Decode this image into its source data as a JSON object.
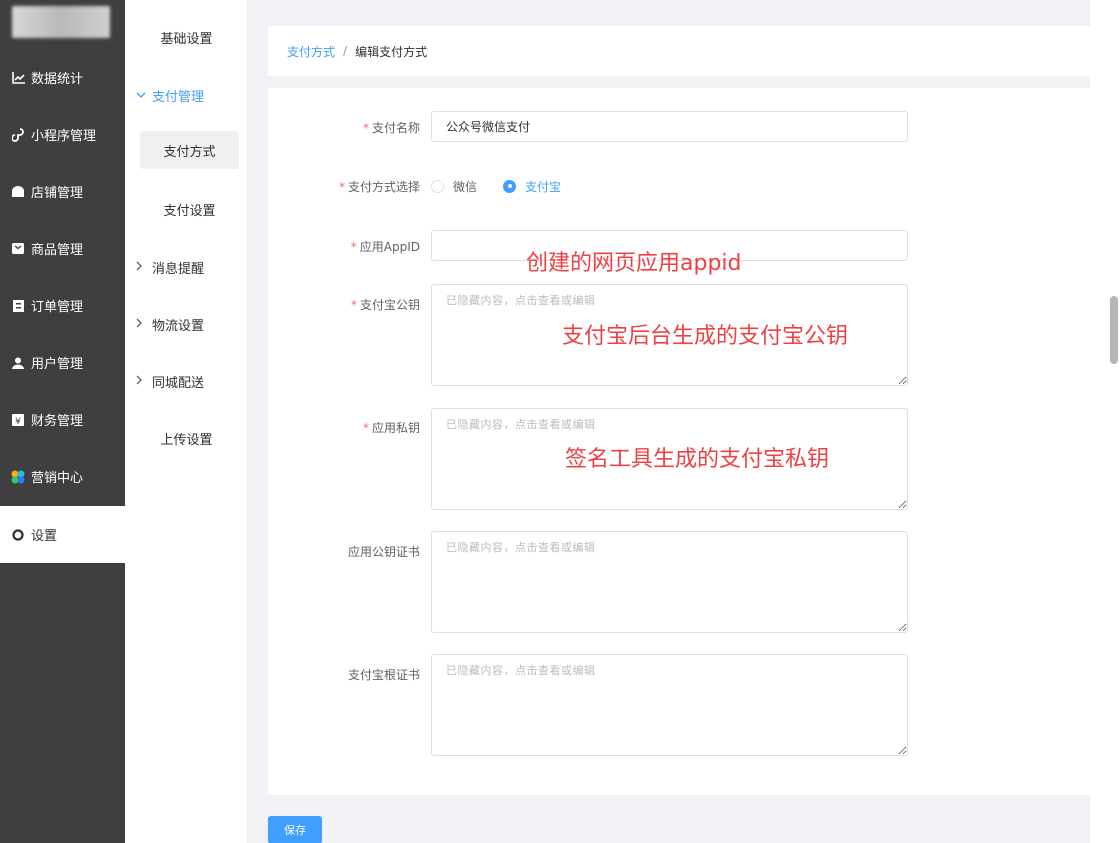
{
  "sidebar": {
    "items": [
      {
        "label": "数据统计",
        "icon": "chart-line-icon"
      },
      {
        "label": "小程序管理",
        "icon": "mini-program-icon"
      },
      {
        "label": "店铺管理",
        "icon": "store-icon"
      },
      {
        "label": "商品管理",
        "icon": "goods-icon"
      },
      {
        "label": "订单管理",
        "icon": "order-icon"
      },
      {
        "label": "用户管理",
        "icon": "user-icon"
      },
      {
        "label": "财务管理",
        "icon": "finance-icon"
      },
      {
        "label": "营销中心",
        "icon": "marketing-icon"
      },
      {
        "label": "设置",
        "icon": "settings-icon"
      }
    ]
  },
  "submenu": {
    "basic": "基础设置",
    "payment_group": "支付管理",
    "payment_methods": "支付方式",
    "payment_settings": "支付设置",
    "message": "消息提醒",
    "logistics": "物流设置",
    "local_delivery": "同城配送",
    "upload": "上传设置"
  },
  "breadcrumb": {
    "parent": "支付方式",
    "separator": "/",
    "current": "编辑支付方式"
  },
  "form": {
    "name_label": "支付名称",
    "name_value": "公众号微信支付",
    "method_label": "支付方式选择",
    "method_options": [
      "微信",
      "支付宝"
    ],
    "method_selected": "支付宝",
    "appid_label": "应用AppID",
    "appid_value": "",
    "alipay_pubkey_label": "支付宝公钥",
    "app_privkey_label": "应用私钥",
    "app_cert_label": "应用公钥证书",
    "alipay_root_cert_label": "支付宝根证书",
    "hidden_placeholder": "已隐藏内容，点击查看或编辑",
    "required_mark": "*"
  },
  "annotations": {
    "appid": "创建的网页应用appid",
    "pubkey": "支付宝后台生成的支付宝公钥",
    "privkey": "签名工具生成的支付宝私钥"
  },
  "save_label": "保存",
  "colors": {
    "sidebar_bg": "#3f3f3f",
    "accent": "#409eff",
    "required": "#f56c6c",
    "annotation": "#f04142"
  }
}
